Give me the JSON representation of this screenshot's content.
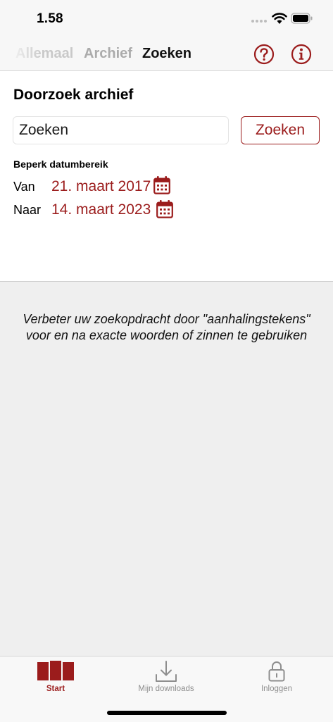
{
  "status_bar": {
    "time": "1.58"
  },
  "top_nav": {
    "tabs": [
      {
        "label": "Allemaal"
      },
      {
        "label": "Archief"
      },
      {
        "label": "Zoeken"
      }
    ],
    "active_tab": "Zoeken",
    "help_icon": "help-circle-icon",
    "info_icon": "info-circle-icon"
  },
  "search": {
    "title": "Doorzoek archief",
    "input_placeholder": "Zoeken",
    "input_value": "",
    "button_label": "Zoeken",
    "range_label": "Beperk datumbereik",
    "from_label": "Van",
    "from_date": "21. maart 2017",
    "to_label": "Naar",
    "to_date": "14. maart 2023",
    "calendar_icon": "calendar-icon"
  },
  "hint": {
    "line1": "Verbeter uw zoekopdracht door \"aanhalingstekens\"",
    "line2": "voor en na exacte woorden of zinnen te gebruiken"
  },
  "tab_bar": {
    "items": [
      {
        "label": "Start",
        "icon": "start-icon"
      },
      {
        "label": "Mijn downloads",
        "icon": "download-icon"
      },
      {
        "label": "Inloggen",
        "icon": "lock-icon"
      }
    ],
    "active": "Start"
  },
  "colors": {
    "accent": "#9b1c1c",
    "background": "#efefef",
    "inactive": "#8e8e8e"
  }
}
